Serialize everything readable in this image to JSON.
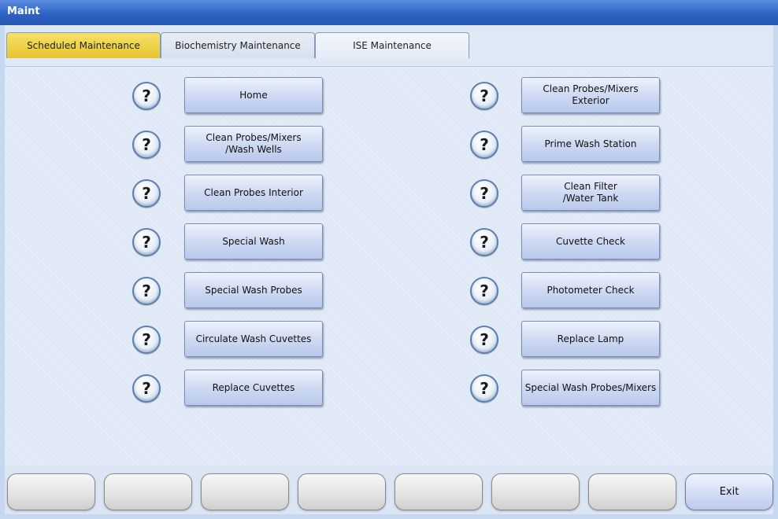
{
  "window": {
    "title": "Maint"
  },
  "tabs": [
    {
      "label": "Scheduled Maintenance",
      "active": true
    },
    {
      "label": "Biochemistry Maintenance"
    },
    {
      "label": "ISE Maintenance"
    }
  ],
  "help_icon_glyph": "?",
  "left_buttons": [
    "Home",
    "Clean Probes/Mixers\n/Wash Wells",
    "Clean Probes Interior",
    "Special Wash",
    "Special Wash Probes",
    "Circulate Wash Cuvettes",
    "Replace Cuvettes"
  ],
  "right_buttons": [
    "Clean Probes/Mixers\nExterior",
    "Prime Wash Station",
    "Clean Filter\n/Water Tank",
    "Cuvette Check",
    "Photometer Check",
    "Replace Lamp",
    "Special Wash Probes/Mixers"
  ],
  "function_keys": [
    "",
    "",
    "",
    "",
    "",
    "",
    "",
    "Exit"
  ],
  "colors": {
    "titlebar": "#2e63c4",
    "active_tab": "#e6c531",
    "panel_background": "#e4ecf8"
  }
}
